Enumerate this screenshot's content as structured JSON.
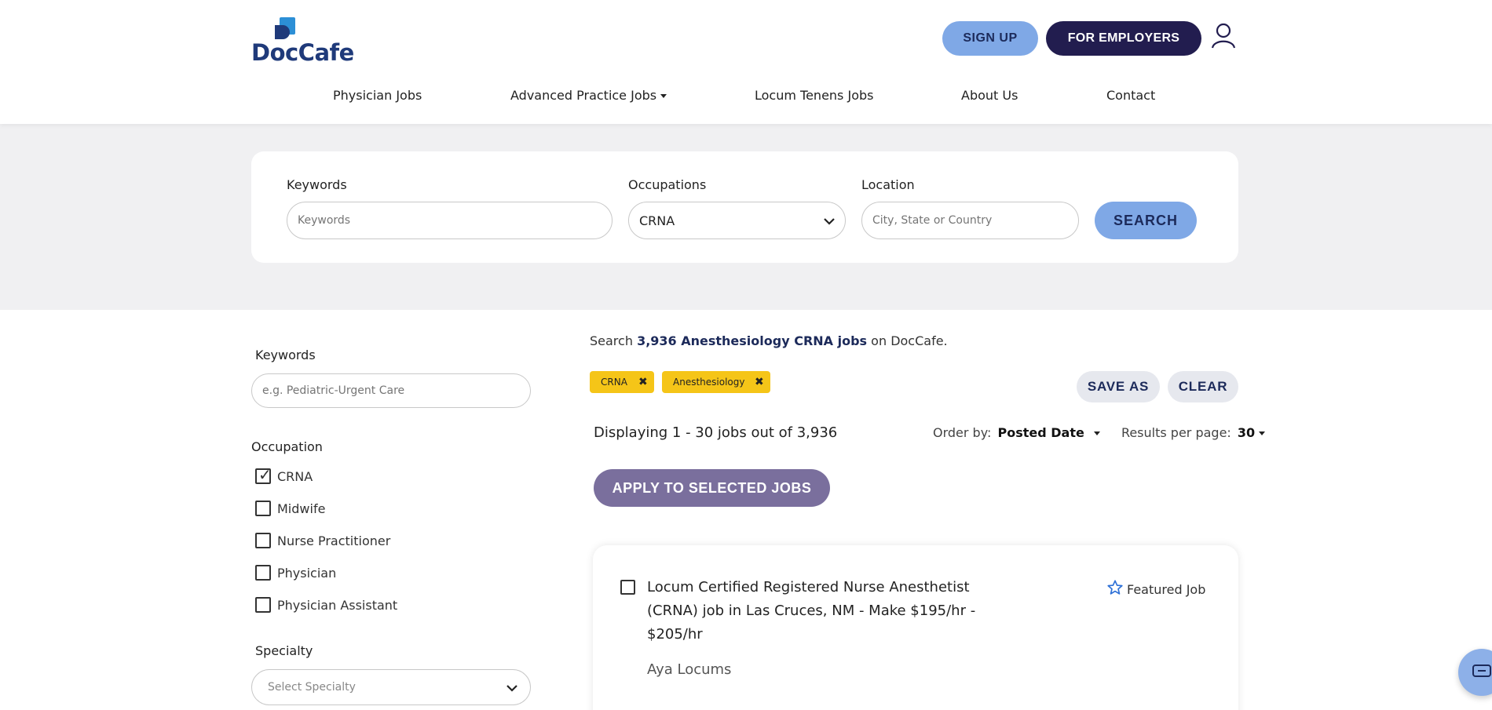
{
  "brand": {
    "name": "DocCafe"
  },
  "header": {
    "signup_label": "SIGN UP",
    "employers_label": "FOR EMPLOYERS"
  },
  "nav": {
    "items": [
      "Physician Jobs",
      "Advanced Practice Jobs",
      "Locum Tenens Jobs",
      "About Us",
      "Contact"
    ]
  },
  "search": {
    "keywords_label": "Keywords",
    "keywords_placeholder": "Keywords",
    "occupations_label": "Occupations",
    "occupation_value": "CRNA",
    "location_label": "Location",
    "location_placeholder": "City, State or Country",
    "search_label": "SEARCH"
  },
  "sidebar": {
    "keywords_label": "Keywords",
    "keywords_placeholder": "e.g. Pediatric-Urgent Care",
    "occupation_label": "Occupation",
    "occupations": [
      {
        "label": "CRNA",
        "checked": true
      },
      {
        "label": "Midwife",
        "checked": false
      },
      {
        "label": "Nurse Practitioner",
        "checked": false
      },
      {
        "label": "Physician",
        "checked": false
      },
      {
        "label": "Physician Assistant",
        "checked": false
      }
    ],
    "specialty_label": "Specialty",
    "specialty_placeholder": "Select Specialty"
  },
  "results": {
    "summary_prefix": "Search",
    "summary_bold": "3,936 Anesthesiology CRNA jobs",
    "summary_suffix": "on DocCafe.",
    "tags": [
      "CRNA",
      "Anesthesiology"
    ],
    "save_as_label": "SAVE AS",
    "clear_label": "CLEAR",
    "displaying": "Displaying 1 - 30 jobs out of 3,936",
    "order_by_label": "Order by:",
    "order_by_value": "Posted Date",
    "per_page_label": "Results per page:",
    "per_page_value": "30",
    "apply_label": "APPLY TO SELECTED JOBS",
    "jobs": [
      {
        "title": "Locum Certified Registered Nurse Anesthetist (CRNA) job in Las Cruces, NM - Make $195/hr - $205/hr",
        "company": "Aya Locums",
        "featured_label": "Featured Job"
      }
    ]
  },
  "colors": {
    "brand_navy": "#221d4f",
    "accent_blue": "#7fa8e6",
    "tag_yellow": "#f5c518",
    "apply_purple": "#7a6f9d"
  }
}
